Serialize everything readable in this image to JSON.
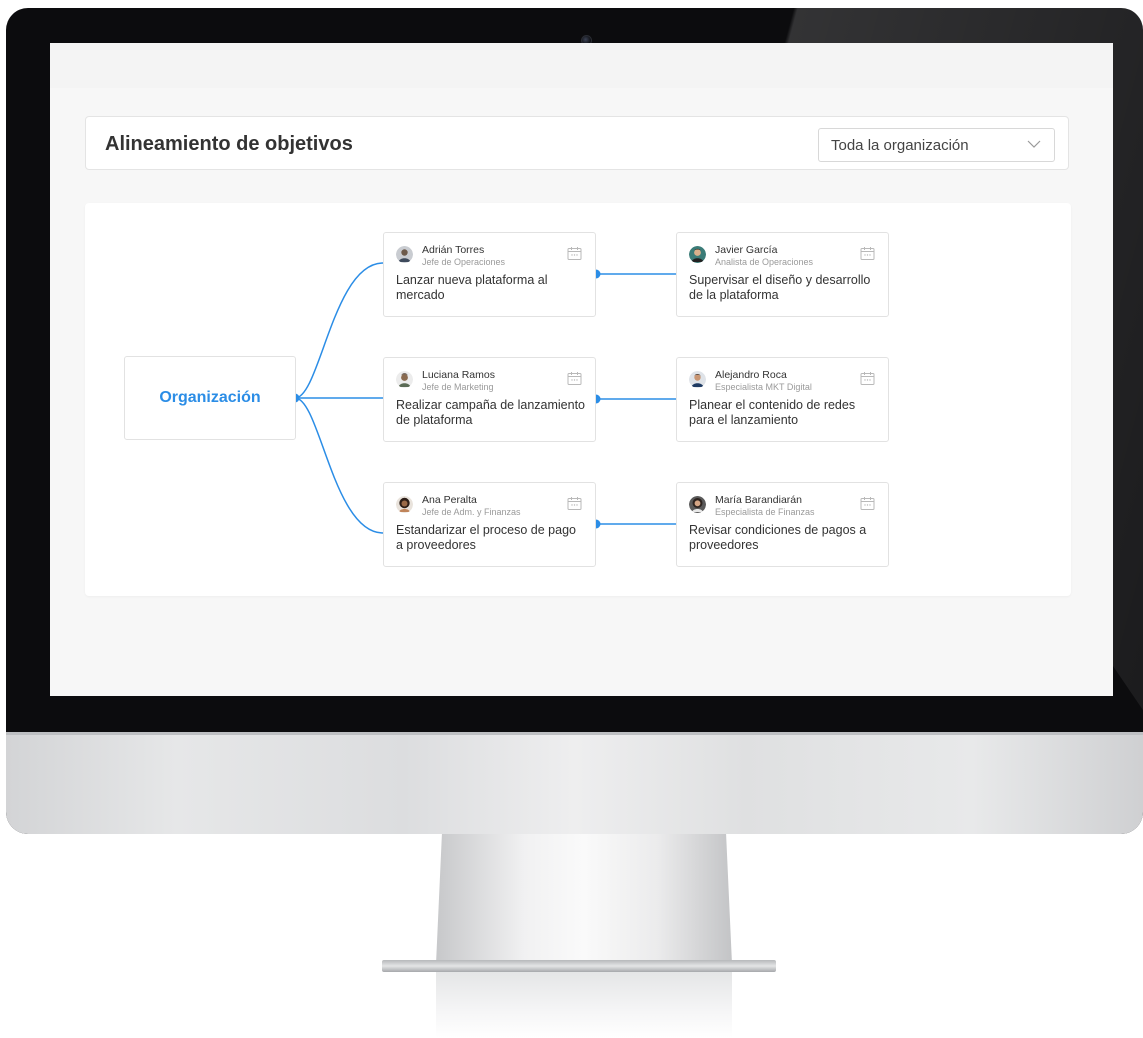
{
  "colors": {
    "accent": "#2b8de6",
    "title_text": "#333333",
    "card_border": "#e2e2e2",
    "screen_bg": "#f7f7f7"
  },
  "header": {
    "title": "Alineamiento de objetivos",
    "filter": {
      "selected": "Toda la organización",
      "icon": "chevron-down-icon"
    }
  },
  "root": {
    "label": "Organización"
  },
  "goals": [
    {
      "owner": "Adrián Torres",
      "role": "Jefe de Operaciones",
      "text": "Lanzar nueva plataforma al mercado",
      "icon": "calendar-icon"
    },
    {
      "owner": "Luciana Ramos",
      "role": "Jefe de Marketing",
      "text": "Realizar campaña de lanzamiento de plataforma",
      "icon": "calendar-icon"
    },
    {
      "owner": "Ana Peralta",
      "role": "Jefe de Adm. y Finanzas",
      "text": "Estandarizar el proceso de pago a proveedores",
      "icon": "calendar-icon"
    }
  ],
  "subgoals": [
    {
      "owner": "Javier García",
      "role": "Analista de Operaciones",
      "text": "Supervisar el diseño y desarrollo de la plataforma",
      "icon": "calendar-icon"
    },
    {
      "owner": "Alejandro Roca",
      "role": "Especialista MKT Digital",
      "text": "Planear el contenido de redes para el lanzamiento",
      "icon": "calendar-icon"
    },
    {
      "owner": "María Barandiarán",
      "role": "Especialista de Finanzas",
      "text": "Revisar condiciones de pagos a proveedores",
      "icon": "calendar-icon"
    }
  ]
}
